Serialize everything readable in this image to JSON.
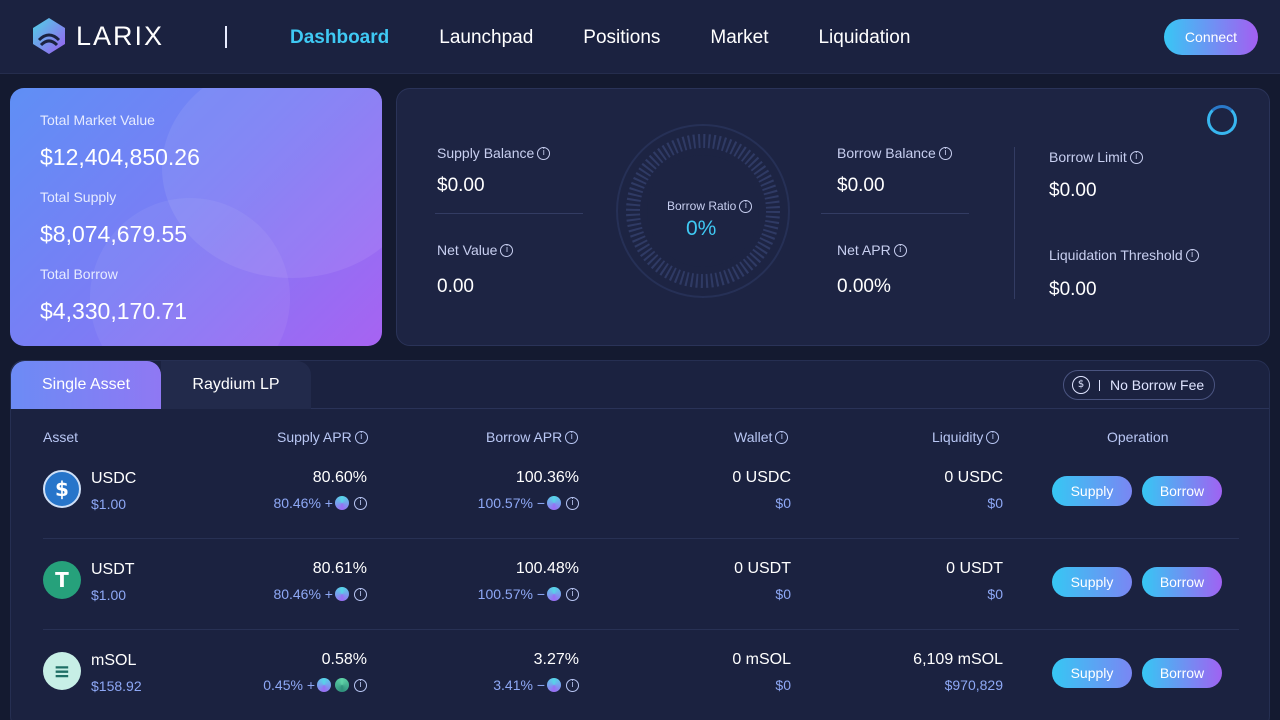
{
  "brand": {
    "name": "LARIX",
    "logo_icon": "larix-logo-icon"
  },
  "nav": {
    "items": [
      {
        "label": "Dashboard",
        "active": true
      },
      {
        "label": "Launchpad",
        "active": false
      },
      {
        "label": "Positions",
        "active": false
      },
      {
        "label": "Market",
        "active": false
      },
      {
        "label": "Liquidation",
        "active": false
      }
    ],
    "connect_label": "Connect"
  },
  "market": {
    "total_market_value_label": "Total Market Value",
    "total_market_value": "$12,404,850.26",
    "total_supply_label": "Total Supply",
    "total_supply": "$8,074,679.55",
    "total_borrow_label": "Total Borrow",
    "total_borrow": "$4,330,170.71"
  },
  "balance": {
    "supply_balance_label": "Supply Balance",
    "supply_balance": "$0.00",
    "net_value_label": "Net Value",
    "net_value": "0.00",
    "borrow_ratio_label": "Borrow Ratio",
    "borrow_ratio": "0%",
    "borrow_balance_label": "Borrow Balance",
    "borrow_balance": "$0.00",
    "net_apr_label": "Net APR",
    "net_apr": "0.00%",
    "borrow_limit_label": "Borrow Limit",
    "borrow_limit": "$0.00",
    "liquidation_threshold_label": "Liquidation Threshold",
    "liquidation_threshold": "$0.00"
  },
  "tabs": {
    "single_asset": "Single Asset",
    "raydium_lp": "Raydium LP",
    "no_borrow_fee": "No Borrow Fee"
  },
  "table": {
    "headers": {
      "asset": "Asset",
      "supply_apr": "Supply APR",
      "borrow_apr": "Borrow APR",
      "wallet": "Wallet",
      "liquidity": "Liquidity",
      "operation": "Operation"
    },
    "supply_label": "Supply",
    "borrow_label": "Borrow",
    "rows": [
      {
        "name": "USDC",
        "price": "$1.00",
        "icon": "usdc-icon",
        "icon_color": "#2775ca",
        "supply_apr": "80.60%",
        "supply_detail": "80.46% +",
        "borrow_apr": "100.36%",
        "borrow_detail": "100.57% −",
        "wallet": "0 USDC",
        "wallet_usd": "$0",
        "liquidity": "0 USDC",
        "liquidity_usd": "$0"
      },
      {
        "name": "USDT",
        "price": "$1.00",
        "icon": "usdt-icon",
        "icon_color": "#26a17b",
        "supply_apr": "80.61%",
        "supply_detail": "80.46% +",
        "borrow_apr": "100.48%",
        "borrow_detail": "100.57% −",
        "wallet": "0 USDT",
        "wallet_usd": "$0",
        "liquidity": "0 USDT",
        "liquidity_usd": "$0"
      },
      {
        "name": "mSOL",
        "price": "$158.92",
        "icon": "msol-icon",
        "icon_color": "#c7efe6",
        "supply_apr": "0.58%",
        "supply_detail": "0.45% +",
        "borrow_apr": "3.27%",
        "borrow_detail": "3.41% −",
        "wallet": "0 mSOL",
        "wallet_usd": "$0",
        "liquidity": "6,109 mSOL",
        "liquidity_usd": "$970,829"
      }
    ]
  }
}
